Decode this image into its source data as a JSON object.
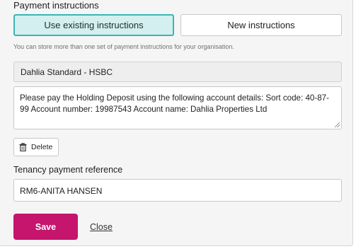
{
  "section_title": "Payment instructions",
  "toggle": {
    "existing_label": "Use existing instructions",
    "new_label": "New instructions"
  },
  "hint": "You can store more than one set of payment instructions for your organisation.",
  "selected_instruction": "Dahlia Standard - HSBC",
  "instruction_text": "Please pay the Holding Deposit using the following account details: Sort code: 40-87-99 Account number: 19987543 Account name: Dahlia Properties Ltd",
  "delete_label": "Delete",
  "reference": {
    "label": "Tenancy payment reference",
    "value": "RM6-ANITA HANSEN"
  },
  "actions": {
    "save_label": "Save",
    "close_label": "Close"
  },
  "colors": {
    "accent": "#3cb4b4",
    "primary_button": "#c5156c"
  },
  "icons": {
    "delete": "trash-icon"
  }
}
